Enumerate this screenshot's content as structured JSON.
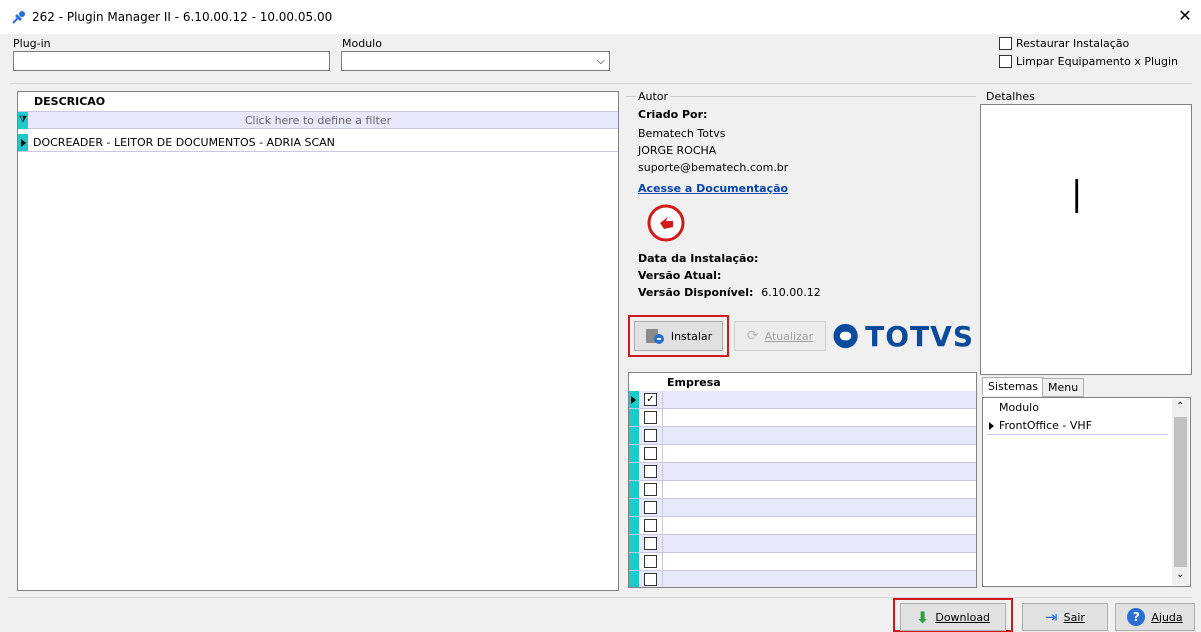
{
  "window": {
    "title": "262 - Plugin Manager II - 6.10.00.12 - 10.00.05.00"
  },
  "filters": {
    "plugin_label": "Plug-in",
    "plugin_value": "",
    "modulo_label": "Modulo",
    "modulo_value": "",
    "restaurar_label": "Restaurar Instalação",
    "limpar_label": "Limpar Equipamento x Plugin"
  },
  "plugin_grid": {
    "header": "DESCRICAO",
    "filter_hint": "Click here to define a filter",
    "rows": [
      "DOCREADER - LEITOR DE DOCUMENTOS - ADRIA SCAN"
    ]
  },
  "autor": {
    "group_label": "Autor",
    "criado_por_label": "Criado Por:",
    "company": "Bematech Totvs",
    "person": "JORGE ROCHA",
    "email": "suporte@bematech.com.br",
    "doc_link": "Acesse a Documentação",
    "data_instalacao_label": "Data da Instalação:",
    "data_instalacao_value": "",
    "versao_atual_label": "Versão Atual:",
    "versao_atual_value": "",
    "versao_disponivel_label": "Versão Disponível:",
    "versao_disponivel_value": "6.10.00.12"
  },
  "actions": {
    "instalar": "Instalar",
    "atualizar": "Atualizar",
    "logo_text": "TOTVS"
  },
  "empresa_grid": {
    "header": "Empresa",
    "rows": [
      {
        "checked": true,
        "name": ""
      },
      {
        "checked": false,
        "name": ""
      },
      {
        "checked": false,
        "name": ""
      },
      {
        "checked": false,
        "name": ""
      },
      {
        "checked": false,
        "name": ""
      },
      {
        "checked": false,
        "name": ""
      },
      {
        "checked": false,
        "name": ""
      },
      {
        "checked": false,
        "name": ""
      },
      {
        "checked": false,
        "name": ""
      },
      {
        "checked": false,
        "name": ""
      },
      {
        "checked": false,
        "name": ""
      }
    ]
  },
  "detalhes": {
    "group_label": "Detalhes",
    "text": "|"
  },
  "tabs": {
    "sistemas": "Sistemas",
    "menu": "Menu"
  },
  "modulo_grid": {
    "header": "Modulo",
    "rows": [
      "FrontOffice - VHF"
    ]
  },
  "footer": {
    "download": "Download",
    "sair": "Sair",
    "ajuda": "Ajuda"
  },
  "colors": {
    "accent_cyan": "#1fc9c9",
    "highlight_red": "#d11a1a",
    "link_blue": "#0645ad",
    "totvs_blue": "#0a4a9c"
  }
}
